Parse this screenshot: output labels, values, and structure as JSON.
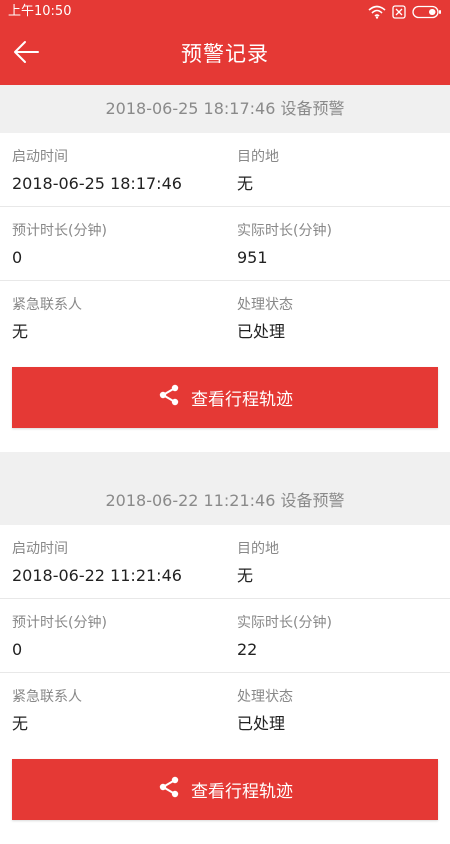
{
  "status_bar": {
    "time": "上午10:50"
  },
  "header": {
    "title": "预警记录"
  },
  "labels": {
    "start_time": "启动时间",
    "destination": "目的地",
    "estimated_duration": "预计时长(分钟)",
    "actual_duration": "实际时长(分钟)",
    "emergency_contact": "紧急联系人",
    "status": "处理状态",
    "track_button": "查看行程轨迹"
  },
  "records": [
    {
      "header": "2018-06-25 18:17:46 设备预警",
      "start_time": "2018-06-25 18:17:46",
      "destination": "无",
      "estimated_duration": "0",
      "actual_duration": "951",
      "emergency_contact": "无",
      "status": "已处理"
    },
    {
      "header": "2018-06-22 11:21:46 设备预警",
      "start_time": "2018-06-22 11:21:46",
      "destination": "无",
      "estimated_duration": "0",
      "actual_duration": "22",
      "emergency_contact": "无",
      "status": "已处理"
    }
  ],
  "colors": {
    "primary": "#e53935",
    "background": "#f0f0f0",
    "label": "#888888",
    "value": "#222222"
  }
}
